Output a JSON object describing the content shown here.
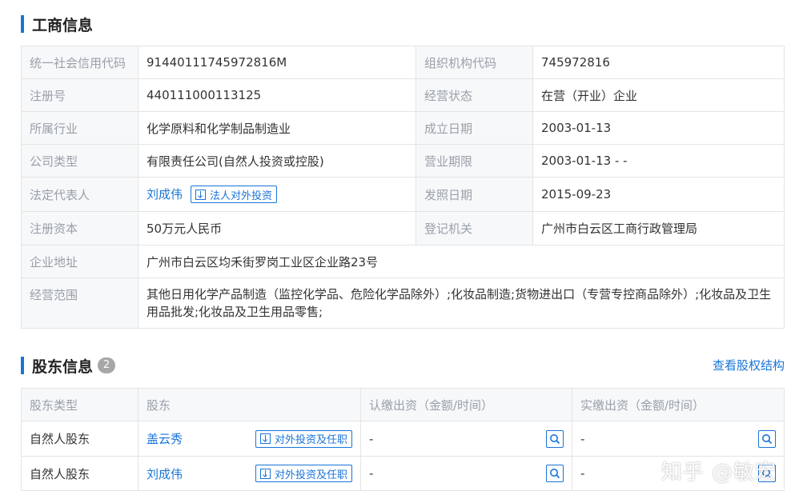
{
  "business": {
    "title": "工商信息",
    "rows": [
      {
        "l1": "统一社会信用代码",
        "v1": "91440111745972816M",
        "l2": "组织机构代码",
        "v2": "745972816"
      },
      {
        "l1": "注册号",
        "v1": "440111000113125",
        "l2": "经营状态",
        "v2": "在营（开业）企业"
      },
      {
        "l1": "所属行业",
        "v1": "化学原料和化学制品制造业",
        "l2": "成立日期",
        "v2": "2003-01-13"
      },
      {
        "l1": "公司类型",
        "v1": "有限责任公司(自然人投资或控股)",
        "l2": "营业期限",
        "v2": "2003-01-13 - -"
      },
      {
        "l1": "法定代表人",
        "v1": "刘成伟",
        "btn": "法人对外投资",
        "l2": "发照日期",
        "v2": "2015-09-23"
      },
      {
        "l1": "注册资本",
        "v1": "50万元人民币",
        "l2": "登记机关",
        "v2": "广州市白云区工商行政管理局"
      }
    ],
    "address_label": "企业地址",
    "address": "广州市白云区均禾街罗岗工业区企业路23号",
    "scope_label": "经营范围",
    "scope": "其他日用化学产品制造（监控化学品、危险化学品除外）;化妆品制造;货物进出口（专营专控商品除外）;化妆品及卫生用品批发;化妆品及卫生用品零售;"
  },
  "shareholders": {
    "title": "股东信息",
    "count": "2",
    "link": "查看股权结构",
    "headers": [
      "股东类型",
      "股东",
      "认缴出资（金额/时间）",
      "实缴出资（金额/时间）"
    ],
    "rows": [
      {
        "type": "自然人股东",
        "name": "盖云秀",
        "btn": "对外投资及任职",
        "subscribed": "-",
        "paid": "-"
      },
      {
        "type": "自然人股东",
        "name": "刘成伟",
        "btn": "对外投资及任职",
        "subscribed": "-",
        "paid": "-"
      }
    ]
  },
  "watermark": "知乎 @敏宏",
  "colors": {
    "accent": "#1a74d8",
    "label_bg": "#f6f8fa",
    "label_text": "#9aa0a8",
    "badge": "#a7a7a7"
  }
}
